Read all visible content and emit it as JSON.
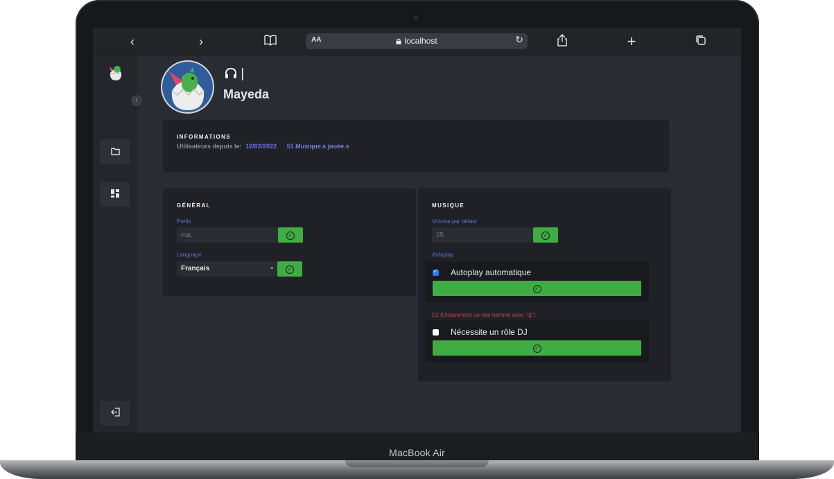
{
  "device": {
    "brand": "MacBook Air"
  },
  "browser": {
    "back_icon": "chevron-left-icon",
    "forward_icon": "chevron-right-icon",
    "reader_label": "AA",
    "url": "localhost",
    "back_glyph": "‹",
    "forward_glyph": "›",
    "bookmarks_glyph": "📖",
    "reload_glyph": "↻",
    "share_glyph": "⇪",
    "new_tab_glyph": "+",
    "tabs_glyph": "⧉",
    "lock_glyph": "🔒"
  },
  "sidebar": {
    "collapse_glyph": "‹",
    "folder_glyph": "🗀",
    "dashboard_glyph": "▦",
    "logout_glyph": "⇤"
  },
  "profile": {
    "headphones_glyph": "🎧",
    "line1_suffix": "|",
    "name": "Mayeda"
  },
  "informations": {
    "title": "INFORMATIONS",
    "since_label": "Utilisateurs depuis le:",
    "since_date": "12/02/2022",
    "played_count": "51",
    "played_label": "Musique.s jouée.s"
  },
  "general": {
    "title": "GÉNÉRAL",
    "prefix_label": "Prefix",
    "prefix_placeholder": "ma.",
    "language_label": "Language",
    "language_value": "Français",
    "chevron_glyph": "⌄",
    "check_glyph": "✓"
  },
  "musique": {
    "title": "MUSIQUE",
    "volume_label": "Volume par défaut",
    "volume_placeholder": "25",
    "autoplay_label": "Autoplay",
    "autoplay_checkbox_label": "Autoplay automatique",
    "dj_label": "DJ (Uniquement un rôle nommé avec \"dj\")",
    "dj_checkbox_label": "Nécessite un rôle DJ",
    "check_glyph": "✓"
  },
  "colors": {
    "accent_green": "#3fad43",
    "highlight_blue": "#6e72e9"
  }
}
